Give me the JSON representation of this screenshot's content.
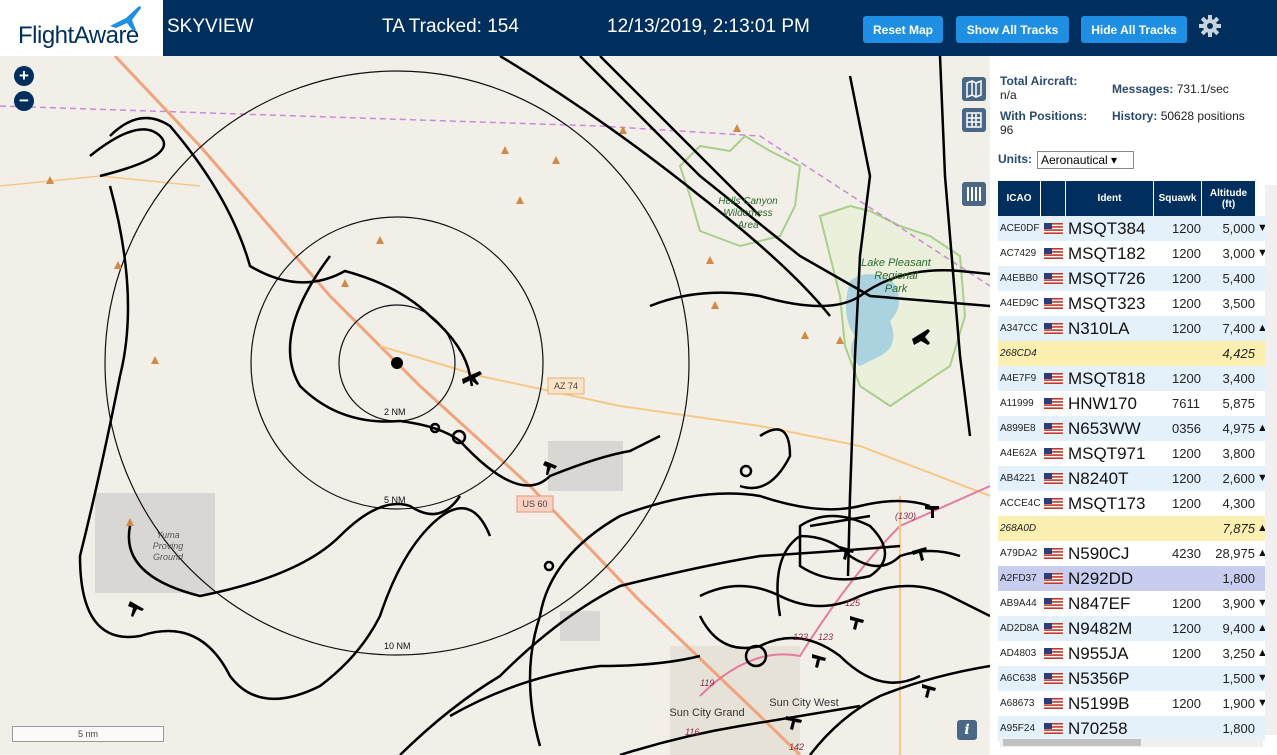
{
  "header": {
    "logo_text": "FlightAware",
    "app_name": "SKYVIEW",
    "ta_tracked": "TA Tracked: 154",
    "datetime": "12/13/2019, 2:13:01 PM",
    "reset_label": "Reset Map",
    "show_label": "Show All Tracks",
    "hide_label": "Hide All Tracks",
    "gear_icon": "gear-icon",
    "brand_color": "#002f5d",
    "button_color": "#1e8fe3"
  },
  "map": {
    "zoom_in": "+",
    "zoom_out": "−",
    "labels": {
      "hells_canyon": "Hells Canyon Wilderness Area",
      "lake_pleasant": "Lake Pleasant Regional Park",
      "yuma": "Yuma Proving Ground",
      "az74": "AZ 74",
      "us60": "US 60",
      "ring2": "2 NM",
      "ring5": "5 NM",
      "ring10": "10 NM",
      "sun_city_grand": "Sun City Grand",
      "sun_city_west": "Sun City West",
      "r130": "(130)",
      "r119": "119",
      "r123": "123",
      "r116": "116",
      "r142": "142",
      "r125": "125"
    },
    "scale_label": "5 nm",
    "info_label": "i"
  },
  "panel": {
    "total_label": "Total Aircraft:",
    "total_value": "n/a",
    "messages_label": "Messages:",
    "messages_value": "731.1/sec",
    "positions_label": "With Positions:",
    "positions_value": "96",
    "history_label": "History:",
    "history_value": "50628 positions",
    "units_label": "Units:",
    "units_value": "Aeronautical ▾",
    "columns": [
      "ICAO",
      "Ident",
      "Squawk",
      "Altitude (ft)"
    ],
    "rows": [
      {
        "icao": "ACE0DF",
        "flag": true,
        "ident": "MSQT384",
        "squawk": "1200",
        "alt": "5,000",
        "arrow": "▼"
      },
      {
        "icao": "AC7429",
        "flag": true,
        "ident": "MSQT182",
        "squawk": "1200",
        "alt": "3,000",
        "arrow": "▼"
      },
      {
        "icao": "A4EBB0",
        "flag": true,
        "ident": "MSQT726",
        "squawk": "1200",
        "alt": "5,400",
        "arrow": ""
      },
      {
        "icao": "A4ED9C",
        "flag": true,
        "ident": "MSQT323",
        "squawk": "1200",
        "alt": "3,500",
        "arrow": ""
      },
      {
        "icao": "A347CC",
        "flag": true,
        "ident": "N310LA",
        "squawk": "1200",
        "alt": "7,400",
        "arrow": "▲"
      },
      {
        "icao": "268CD4",
        "flag": false,
        "ident": "",
        "squawk": "",
        "alt": "4,425",
        "arrow": "",
        "style": "yellow"
      },
      {
        "icao": "A4E7F9",
        "flag": true,
        "ident": "MSQT818",
        "squawk": "1200",
        "alt": "3,400",
        "arrow": ""
      },
      {
        "icao": "A11999",
        "flag": true,
        "ident": "HNW170",
        "squawk": "7611",
        "alt": "5,875",
        "arrow": ""
      },
      {
        "icao": "A899E8",
        "flag": true,
        "ident": "N653WW",
        "squawk": "0356",
        "alt": "4,975",
        "arrow": "▲"
      },
      {
        "icao": "A4E62A",
        "flag": true,
        "ident": "MSQT971",
        "squawk": "1200",
        "alt": "3,800",
        "arrow": ""
      },
      {
        "icao": "AB4221",
        "flag": true,
        "ident": "N8240T",
        "squawk": "1200",
        "alt": "2,600",
        "arrow": "▼"
      },
      {
        "icao": "ACCE4C",
        "flag": true,
        "ident": "MSQT173",
        "squawk": "1200",
        "alt": "4,300",
        "arrow": ""
      },
      {
        "icao": "268A0D",
        "flag": false,
        "ident": "",
        "squawk": "",
        "alt": "7,875",
        "arrow": "▲",
        "style": "yellow"
      },
      {
        "icao": "A79DA2",
        "flag": true,
        "ident": "N590CJ",
        "squawk": "4230",
        "alt": "28,975",
        "arrow": "▲"
      },
      {
        "icao": "A2FD37",
        "flag": true,
        "ident": "N292DD",
        "squawk": "",
        "alt": "1,800",
        "arrow": "",
        "style": "selected"
      },
      {
        "icao": "AB9A44",
        "flag": true,
        "ident": "N847EF",
        "squawk": "1200",
        "alt": "3,900",
        "arrow": "▼"
      },
      {
        "icao": "AD2D8A",
        "flag": true,
        "ident": "N9482M",
        "squawk": "1200",
        "alt": "9,400",
        "arrow": "▲"
      },
      {
        "icao": "AD4803",
        "flag": true,
        "ident": "N955JA",
        "squawk": "1200",
        "alt": "3,250",
        "arrow": "▲"
      },
      {
        "icao": "A6C638",
        "flag": true,
        "ident": "N5356P",
        "squawk": "",
        "alt": "1,500",
        "arrow": "▼"
      },
      {
        "icao": "A68673",
        "flag": true,
        "ident": "N5199B",
        "squawk": "1200",
        "alt": "1,900",
        "arrow": "▼"
      },
      {
        "icao": "A95F24",
        "flag": true,
        "ident": "N70258",
        "squawk": "",
        "alt": "1,800",
        "arrow": ""
      }
    ]
  }
}
